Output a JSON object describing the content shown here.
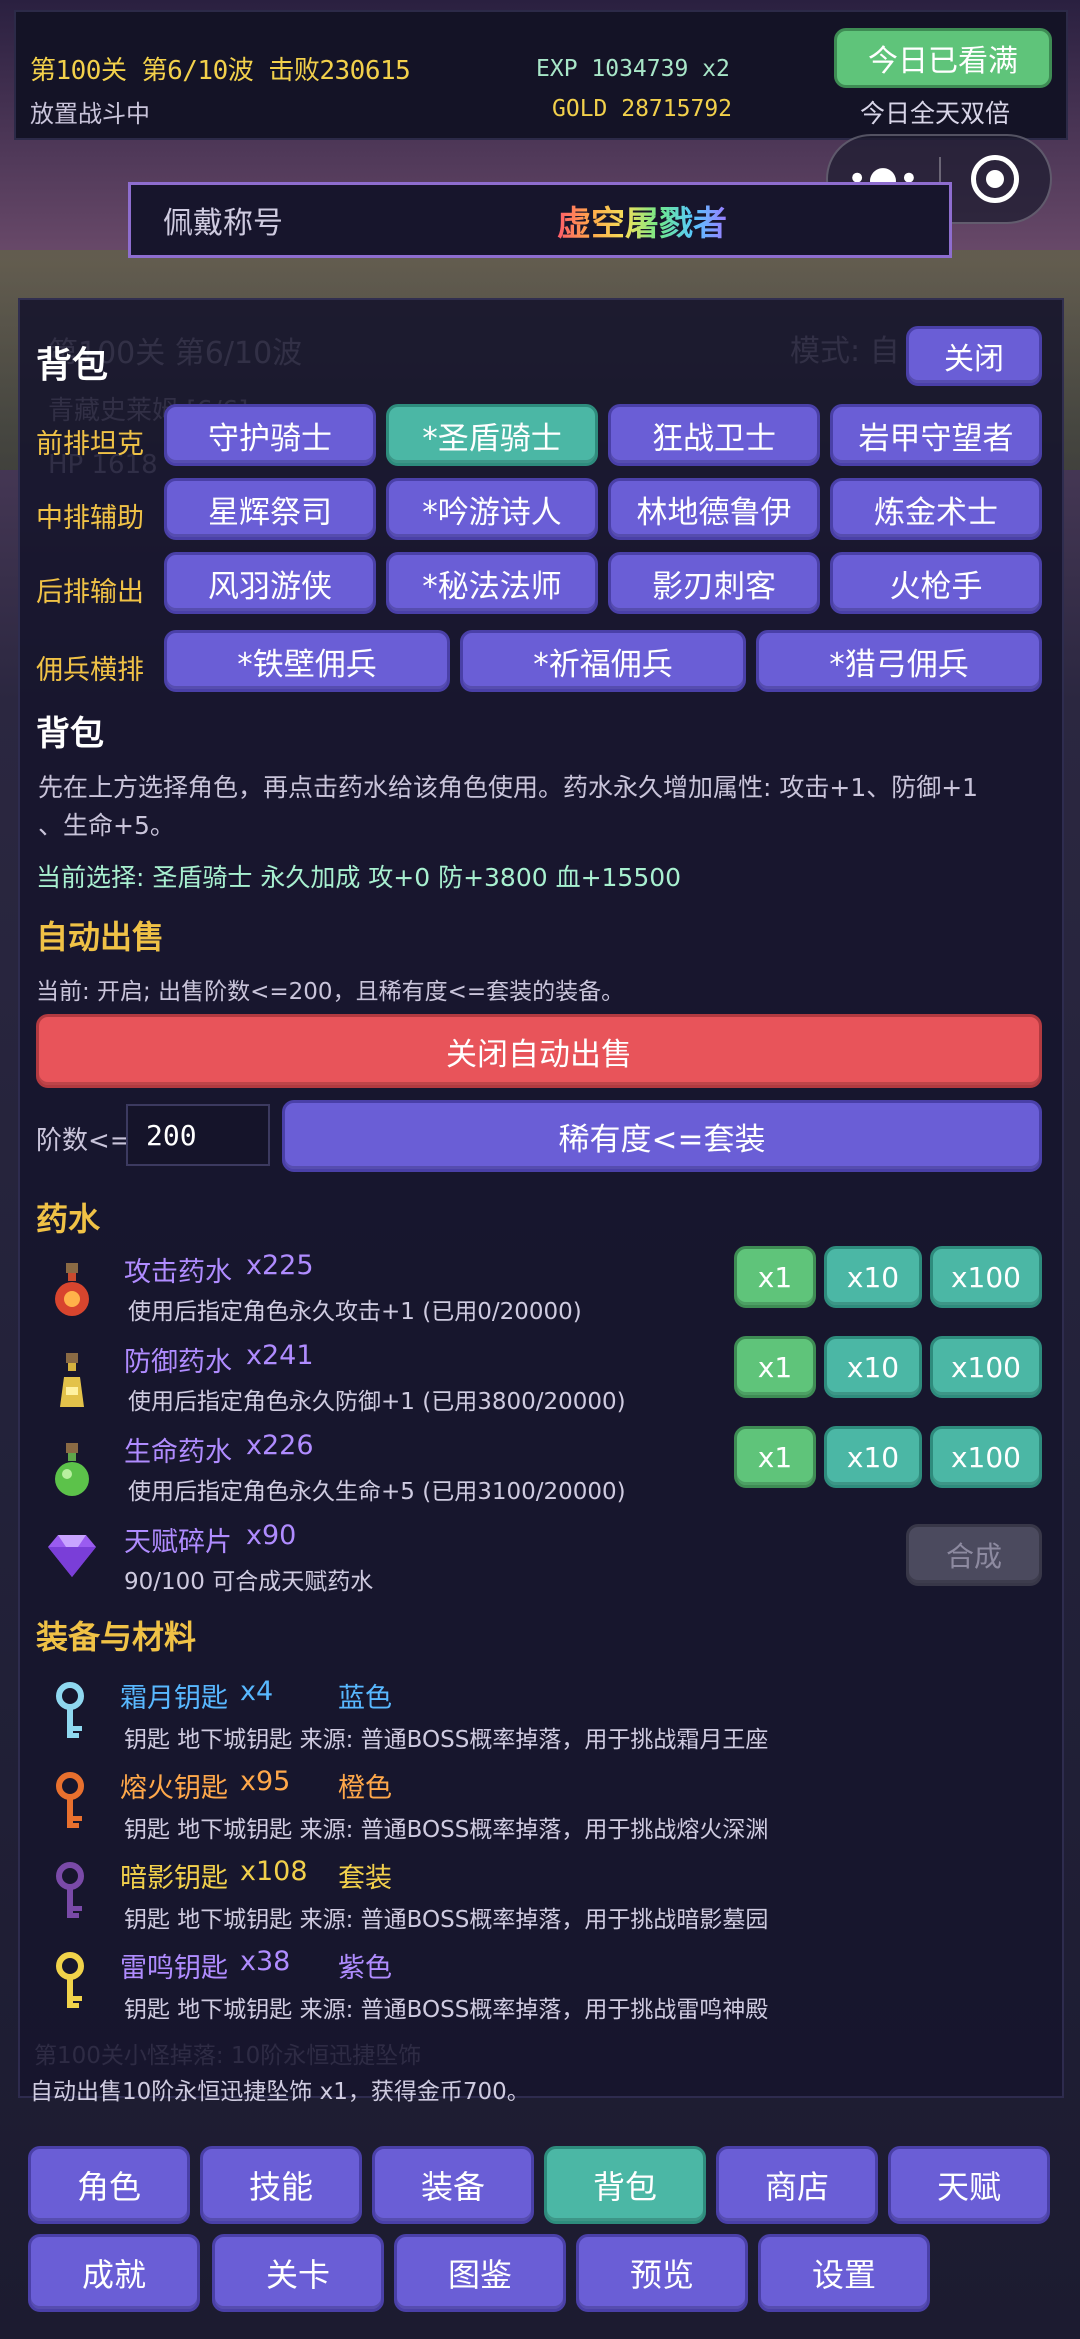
{
  "hud": {
    "stage_text": "第100关 第6/10波  击败230615",
    "status": "放置战斗中",
    "exp": "EXP 1034739 x2",
    "gold": "GOLD 28715792",
    "watch_btn": "今日已看满",
    "double_text": "今日全天双倍"
  },
  "title_bar": {
    "label": "佩戴称号",
    "value": "虚空屠戮者"
  },
  "ghost": {
    "stage": "第100关 第6/10波",
    "mode": "模式: 自",
    "hero": "青藏史莱姆 [6/6]",
    "hp": "HP 1618",
    "log": "第100关小怪掉落: 10阶永恒迅捷坠饰"
  },
  "bag": {
    "title": "背包",
    "close": "关闭",
    "rows": [
      {
        "label": "前排坦克",
        "heroes": [
          "守护骑士",
          "*圣盾骑士",
          "狂战卫士",
          "岩甲守望者"
        ],
        "selected": 1
      },
      {
        "label": "中排辅助",
        "heroes": [
          "星辉祭司",
          "*吟游诗人",
          "林地德鲁伊",
          "炼金术士"
        ],
        "selected": -1
      },
      {
        "label": "后排输出",
        "heroes": [
          "风羽游侠",
          "*秘法法师",
          "影刃刺客",
          "火枪手"
        ],
        "selected": -1
      },
      {
        "label": "佣兵横排",
        "heroes": [
          "*铁壁佣兵",
          "*祈福佣兵",
          "*猎弓佣兵"
        ],
        "selected": -1
      }
    ],
    "subtitle": "背包",
    "hint_line1": "先在上方选择角色，再点击药水给该角色使用。药水永久增加属性: 攻击+1、防御+1",
    "hint_line2": "、生命+5。",
    "current": "当前选择: 圣盾骑士  永久加成 攻+0 防+3800 血+15500"
  },
  "auto_sell": {
    "title": "自动出售",
    "status": "当前: 开启; 出售阶数<=200，且稀有度<=套装的装备。",
    "toggle": "关闭自动出售",
    "tier_label": "阶数<=",
    "tier_value": "200",
    "rarity_btn": "稀有度<=套装"
  },
  "potions": {
    "title": "药水",
    "items": [
      {
        "name": "攻击药水",
        "count": "x225",
        "desc": "使用后指定角色永久攻击+1 (已用0/20000)",
        "icon": "red-potion-icon"
      },
      {
        "name": "防御药水",
        "count": "x241",
        "desc": "使用后指定角色永久防御+1 (已用3800/20000)",
        "icon": "yellow-potion-icon"
      },
      {
        "name": "生命药水",
        "count": "x226",
        "desc": "使用后指定角色永久生命+5 (已用3100/20000)",
        "icon": "green-potion-icon"
      }
    ],
    "buttons": [
      "x1",
      "x10",
      "x100"
    ],
    "talent": {
      "name": "天赋碎片",
      "count": "x90",
      "desc": "90/100 可合成天赋药水",
      "btn": "合成",
      "icon": "purple-gem-icon"
    }
  },
  "equipment": {
    "title": "装备与材料",
    "items": [
      {
        "name": "霜月钥匙",
        "count": "x4",
        "rarity": "蓝色",
        "desc": "钥匙  地下城钥匙  来源: 普通BOSS概率掉落，用于挑战霜月王座",
        "color": "#58b8ff",
        "rcolor": "#58b8ff"
      },
      {
        "name": "熔火钥匙",
        "count": "x95",
        "rarity": "橙色",
        "desc": "钥匙  地下城钥匙  来源: 普通BOSS概率掉落，用于挑战熔火深渊",
        "color": "#ffa84a",
        "rcolor": "#ffa84a"
      },
      {
        "name": "暗影钥匙",
        "count": "x108",
        "rarity": "套装",
        "desc": "钥匙  地下城钥匙  来源: 普通BOSS概率掉落，用于挑战暗影墓园",
        "color": "#f2d04b",
        "rcolor": "#f2d04b"
      },
      {
        "name": "雷鸣钥匙",
        "count": "x38",
        "rarity": "紫色",
        "desc": "钥匙  地下城钥匙  来源: 普通BOSS概率掉落，用于挑战雷鸣神殿",
        "color": "#b08cff",
        "rcolor": "#b08cff"
      }
    ]
  },
  "log": {
    "line1": "第100关小怪掉落: 10阶永恒迅捷坠饰",
    "line2": "自动出售10阶永恒迅捷坠饰 x1，获得金币700。"
  },
  "nav": {
    "row1": [
      "角色",
      "技能",
      "装备",
      "背包",
      "商店",
      "天赋"
    ],
    "row2": [
      "成就",
      "关卡",
      "图鉴",
      "预览",
      "设置"
    ],
    "active": "背包"
  }
}
